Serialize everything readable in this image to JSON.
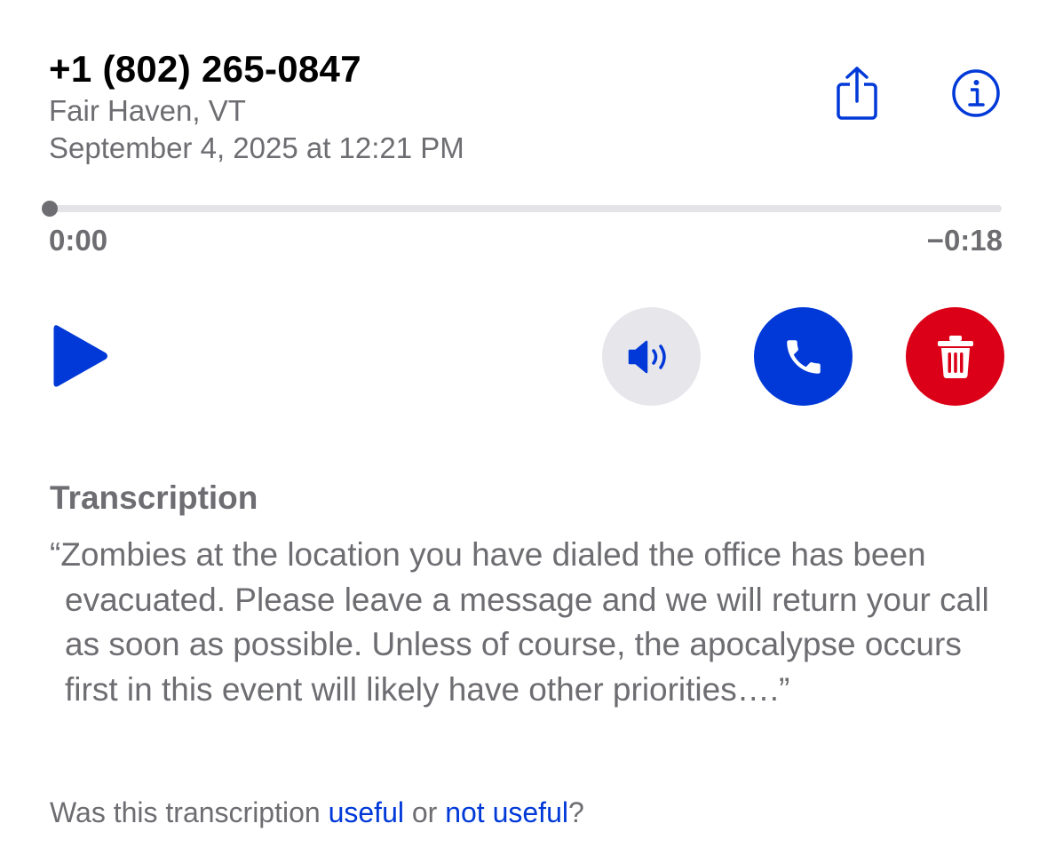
{
  "header": {
    "phone_number": "+1 (802) 265-0847",
    "location": "Fair Haven, VT",
    "datetime": "September 4, 2025 at 12:21 PM",
    "share_icon": "share-icon",
    "info_icon": "info-icon"
  },
  "player": {
    "elapsed": "0:00",
    "remaining": "−0:18",
    "progress": 0,
    "play_icon": "play-icon",
    "speaker_icon": "speaker-icon",
    "call_icon": "phone-icon",
    "delete_icon": "trash-icon"
  },
  "transcription": {
    "heading": "Transcription",
    "text": "“Zombies at the location you have dialed the office has been evacuated. Please leave a message and we will return your call as soon as possible. Unless of course, the apocalypse occurs first in this event will likely have other priorities….”"
  },
  "feedback": {
    "prefix": "Was this transcription ",
    "useful_label": "useful",
    "middle": " or ",
    "not_useful_label": "not useful",
    "suffix": "?"
  },
  "colors": {
    "accent_blue": "#0039d8",
    "delete_red": "#db0017",
    "secondary_text": "#6d6d72",
    "speaker_bg": "#e6e6eb",
    "track": "#e3e3e8"
  }
}
